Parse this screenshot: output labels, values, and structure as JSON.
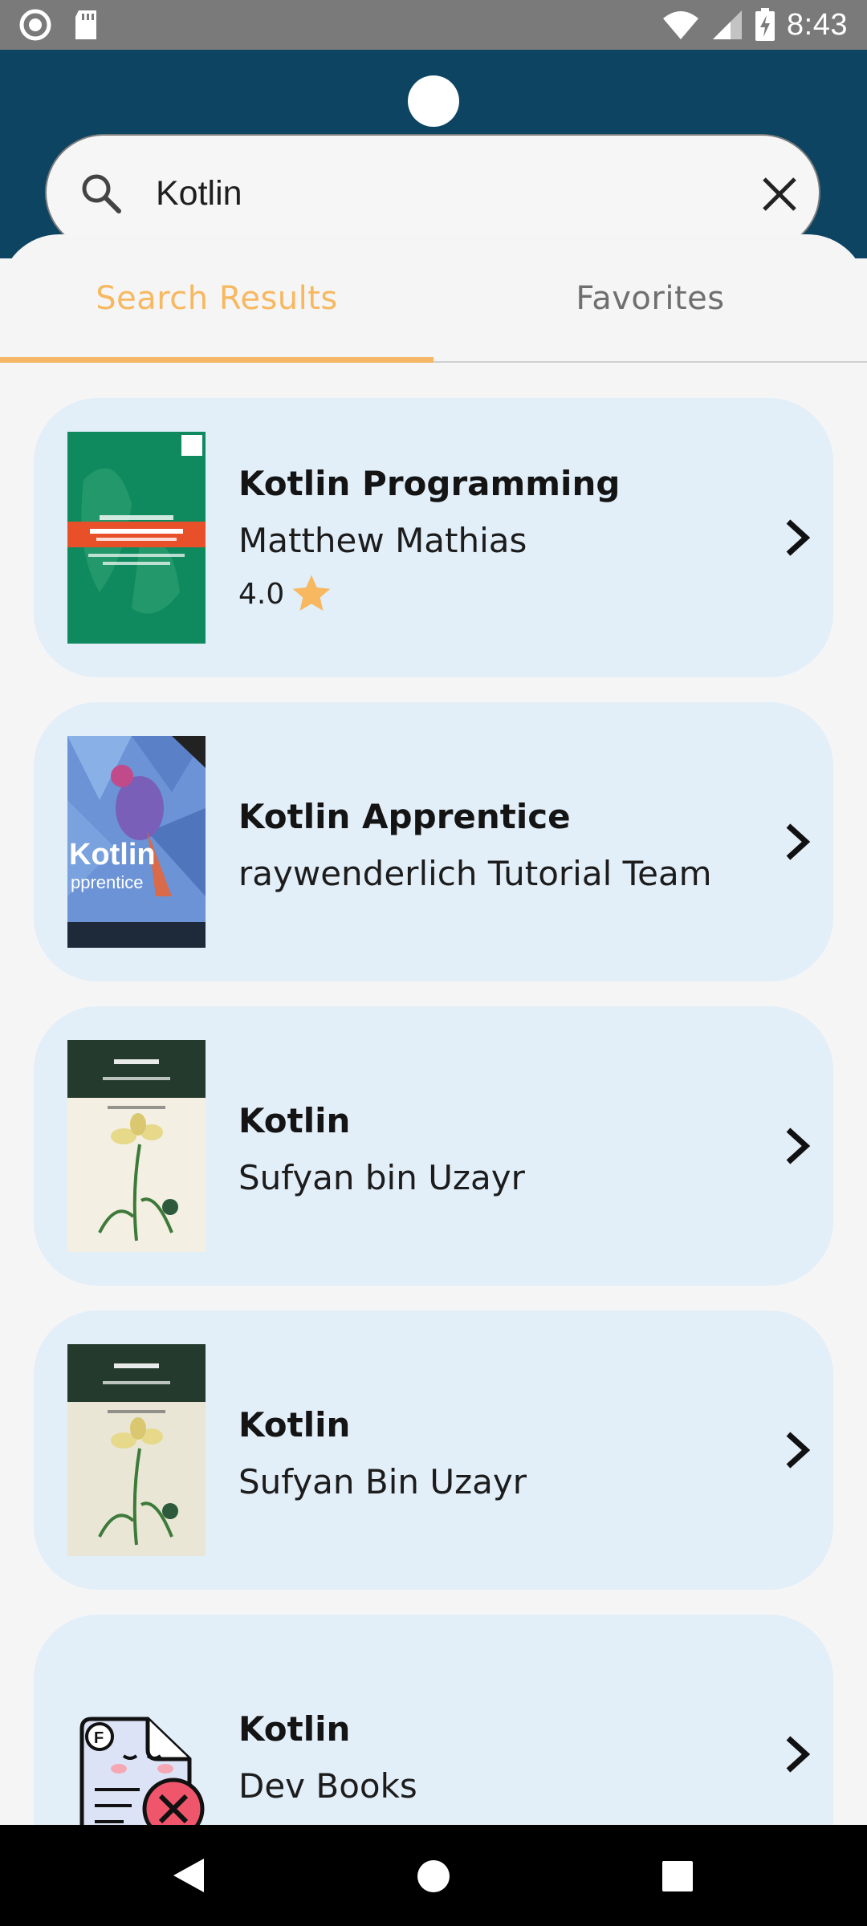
{
  "status_bar": {
    "time": "8:43",
    "icons": [
      "record-icon",
      "sd-card-icon",
      "wifi-icon",
      "signal-icon",
      "battery-charging-icon"
    ]
  },
  "search": {
    "value": "Kotlin",
    "icon": "search-icon",
    "clear_icon": "close-icon"
  },
  "tabs": [
    {
      "label": "Search Results",
      "active": true
    },
    {
      "label": "Favorites",
      "active": false
    }
  ],
  "colors": {
    "header_bg": "#0d4462",
    "accent": "#f5b766",
    "card_bg": "#e2eef8",
    "star": "#f7b860"
  },
  "books": [
    {
      "title": "Kotlin Programming",
      "author": "Matthew Mathias",
      "rating": "4.0",
      "cover": "green-cover"
    },
    {
      "title": "Kotlin Apprentice",
      "author": "raywenderlich Tutorial Team",
      "cover": "parrot-cover"
    },
    {
      "title": "Kotlin",
      "author": "Sufyan bin Uzayr",
      "cover": "iris-cover"
    },
    {
      "title": "Kotlin",
      "author": "Sufyan Bin Uzayr",
      "cover": "iris-cover"
    },
    {
      "title": "Kotlin",
      "author": "Dev Books",
      "cover": "placeholder-file-error-icon"
    }
  ],
  "nav": [
    "back-icon",
    "home-icon",
    "recents-icon"
  ]
}
